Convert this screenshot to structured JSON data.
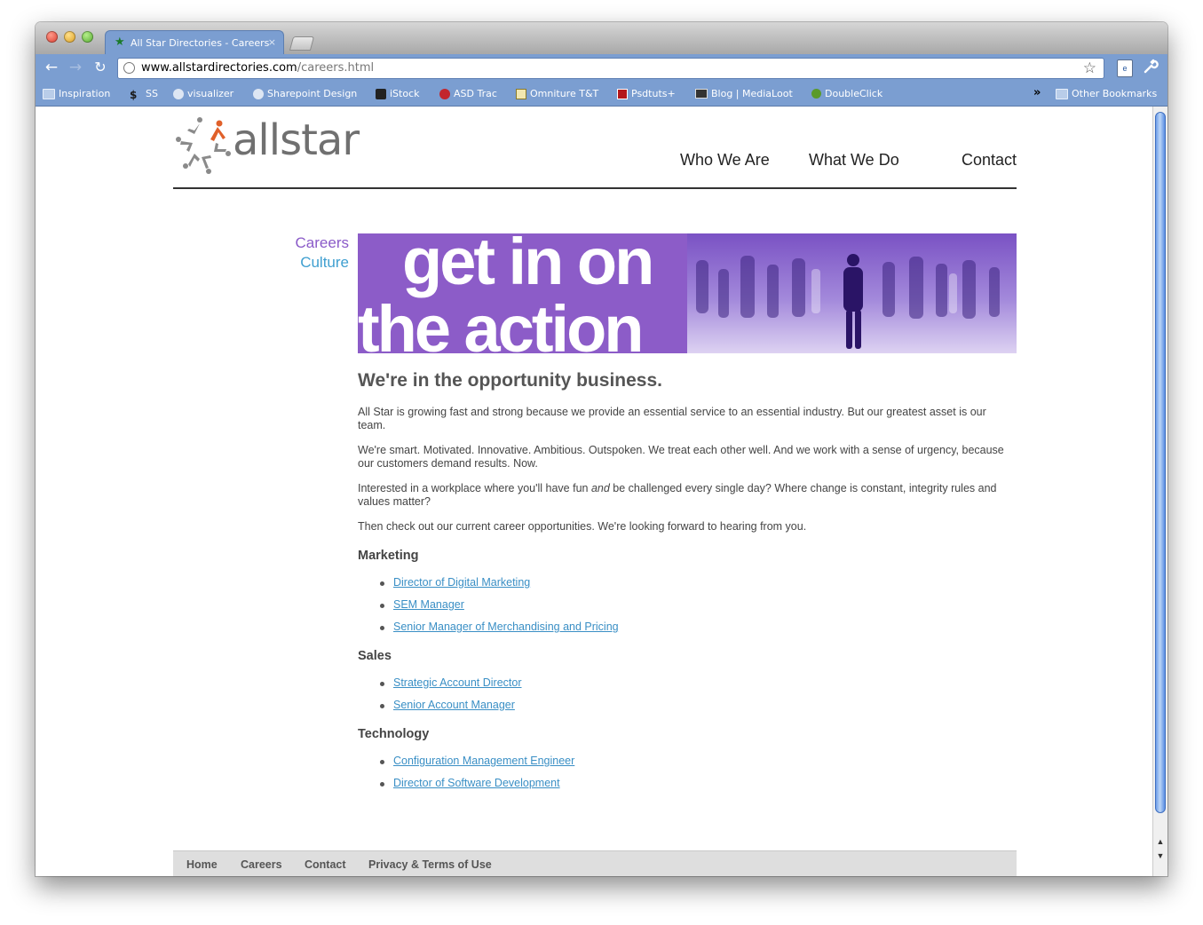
{
  "browser": {
    "tab_title": "All Star Directories - Careers",
    "tab_close": "×",
    "url_host": "www.allstardirectories.com",
    "url_path": "/careers.html",
    "nav_back": "←",
    "nav_forward": "→",
    "nav_reload": "↻",
    "star": "☆",
    "wrench": "🔧",
    "bookmarks": [
      {
        "label": "Inspiration",
        "icon": "folder-icon"
      },
      {
        "label": "SS",
        "icon": "ss-icon"
      },
      {
        "label": "visualizer",
        "icon": "globe-icon"
      },
      {
        "label": "Sharepoint Design",
        "icon": "globe-icon"
      },
      {
        "label": "iStock",
        "icon": "istock-icon"
      },
      {
        "label": "ASD Trac",
        "icon": "trac-icon"
      },
      {
        "label": "Omniture T&T",
        "icon": "chart-icon"
      },
      {
        "label": "Psdtuts+",
        "icon": "psdtuts-icon"
      },
      {
        "label": "Blog | MediaLoot",
        "icon": "medialoot-icon"
      },
      {
        "label": "DoubleClick",
        "icon": "doubleclick-icon"
      }
    ],
    "overflow": "»",
    "other_bookmarks": "Other Bookmarks"
  },
  "page": {
    "logo_text": "allstar",
    "nav": {
      "who": "Who We Are",
      "what": "What We Do",
      "contact": "Contact"
    },
    "sidenav": {
      "careers": "Careers",
      "culture": "Culture"
    },
    "hero": {
      "line1": "get in on",
      "line2": "the action"
    },
    "headline": "We're in the opportunity business.",
    "paragraphs": {
      "p1": "All Star is growing fast and strong because we provide an essential service to an essential industry. But our greatest asset is our team.",
      "p2": "We're smart. Motivated. Innovative. Ambitious. Outspoken. We treat each other well. And we work with a sense of urgency, because our customers demand results. Now.",
      "p3_before": "Interested in a workplace where you'll have fun ",
      "p3_em": "and",
      "p3_after": " be challenged every single day? Where change is constant, integrity rules and values matter?",
      "p4": "Then check out our current career opportunities. We're looking forward to hearing from you."
    },
    "categories": [
      {
        "title": "Marketing",
        "jobs": [
          "Director of Digital Marketing",
          "SEM Manager",
          "Senior Manager of Merchandising and Pricing"
        ]
      },
      {
        "title": "Sales",
        "jobs": [
          "Strategic Account Director",
          "Senior Account Manager"
        ]
      },
      {
        "title": "Technology",
        "jobs": [
          "Configuration Management Engineer",
          "Director of Software Development"
        ]
      }
    ],
    "footer": {
      "home": "Home",
      "careers": "Careers",
      "contact": "Contact",
      "privacy": "Privacy & Terms of Use"
    },
    "colors": {
      "purple": "#8c5cc8",
      "link_blue": "#3a8fc5",
      "chrome_blue": "#7b9ed1"
    }
  }
}
